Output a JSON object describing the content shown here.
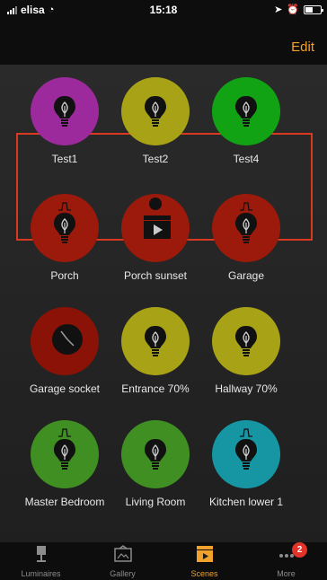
{
  "status_bar": {
    "carrier": "elisa",
    "time": "15:18"
  },
  "header": {
    "edit_label": "Edit"
  },
  "scenes": [
    {
      "label": "Test1",
      "color": "#9c2a9c",
      "icon": "lightbulb-icon"
    },
    {
      "label": "Test2",
      "color": "#a8a316",
      "icon": "lightbulb-icon"
    },
    {
      "label": "Test4",
      "color": "#12a315",
      "icon": "lightbulb-icon"
    },
    {
      "label": "Porch",
      "color": "#9b1a0c",
      "icon": "lightbulb-icon"
    },
    {
      "label": "Porch sunset",
      "color": "#9b1a0c",
      "icon": "clapperboard-icon"
    },
    {
      "label": "Garage",
      "color": "#9b1a0c",
      "icon": "lightbulb-icon"
    },
    {
      "label": "Garage socket",
      "color": "#8a1207",
      "icon": "socket-icon"
    },
    {
      "label": "Entrance 70%",
      "color": "#a8a316",
      "icon": "lightbulb-icon"
    },
    {
      "label": "Hallway 70%",
      "color": "#a8a316",
      "icon": "lightbulb-icon"
    },
    {
      "label": "Master Bedroom",
      "color": "#3f8f22",
      "icon": "lightbulb-icon"
    },
    {
      "label": "Living Room",
      "color": "#3f8f22",
      "icon": "lightbulb-icon"
    },
    {
      "label": "Kitchen lower 1",
      "color": "#1696a3",
      "icon": "lightbulb-icon"
    }
  ],
  "tab_bar": {
    "tabs": [
      {
        "label": "Luminaires",
        "icon": "lamp-icon",
        "active": false
      },
      {
        "label": "Gallery",
        "icon": "gallery-icon",
        "active": false
      },
      {
        "label": "Scenes",
        "icon": "clapperboard-icon",
        "active": true
      },
      {
        "label": "More",
        "icon": "more-icon",
        "active": false,
        "badge": "2"
      }
    ]
  }
}
